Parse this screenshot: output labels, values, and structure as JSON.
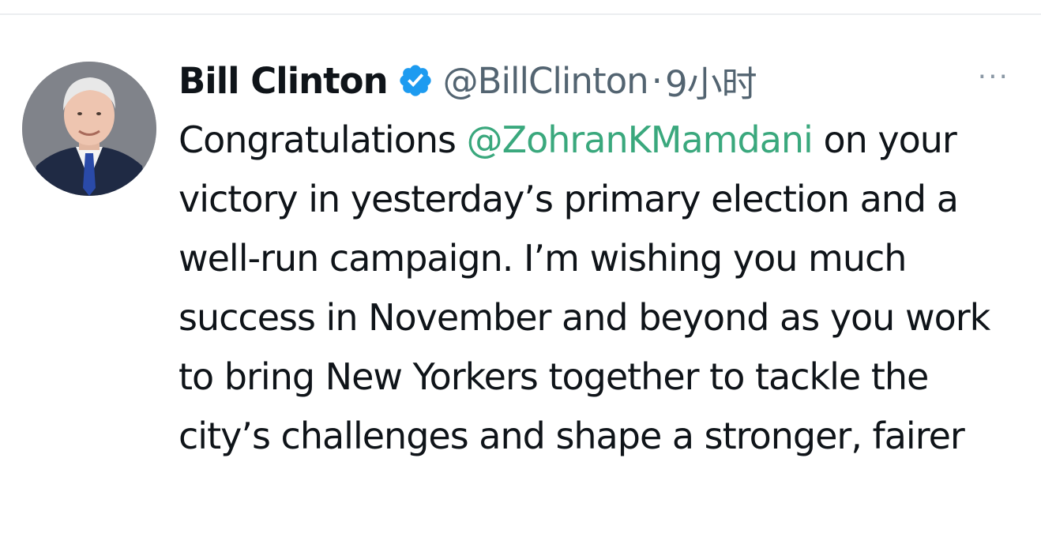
{
  "tweet": {
    "author": {
      "display_name": "Bill Clinton",
      "handle": "@BillClinton",
      "verified_icon": "verified-badge-icon",
      "avatar": "profile-photo"
    },
    "separator": "·",
    "timestamp": "9小时",
    "more_icon": "more-options-icon",
    "more_label": "···",
    "body": {
      "lead": "Congratulations ",
      "mention": "@ZohranKMamdani",
      "rest": " on your victory in yesterday’s primary election and a well-run campaign. I’m wishing you much success in November and beyond as you work to bring New Yorkers together to tackle the city’s challenges and shape a stronger, fairer"
    }
  },
  "colors": {
    "mention": "#3aa87d",
    "verified": "#1d9bf0",
    "secondary_text": "#536471"
  }
}
